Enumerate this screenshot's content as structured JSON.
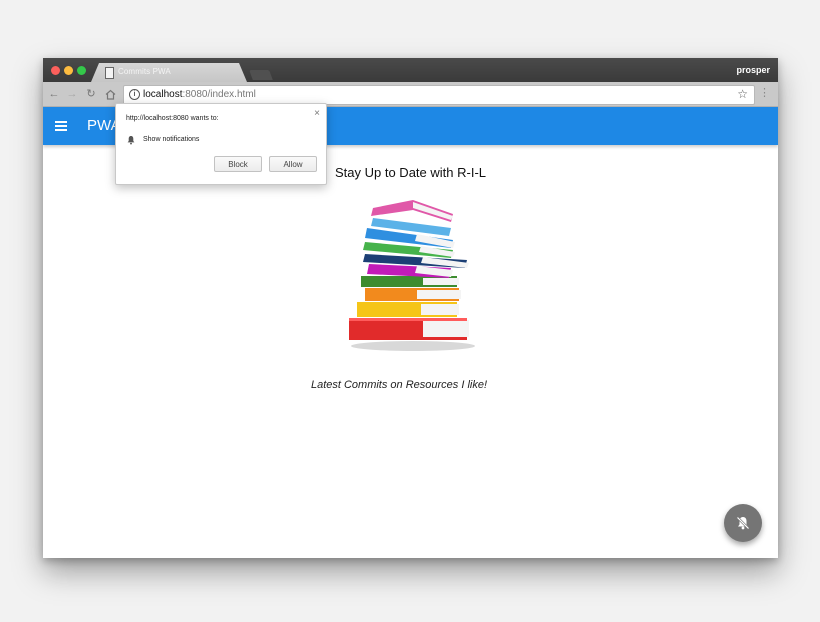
{
  "browser": {
    "tab_title": "Commits PWA",
    "profile_name": "prosper",
    "url_host": "localhost",
    "url_rest": ":8080/index.html",
    "icons": {
      "back": "arrow-left-icon",
      "forward": "arrow-right-icon",
      "reload": "reload-icon",
      "home": "home-icon",
      "info": "info-icon",
      "bookmark": "star-icon",
      "menu": "vertical-dots-icon"
    }
  },
  "app": {
    "title": "PWA",
    "heading": "Stay Up to Date with R-I-L",
    "caption": "Latest Commits on Resources I like!",
    "accent_color": "#1e88e5",
    "fab_icon": "bell-off-icon"
  },
  "permission_popup": {
    "origin_text": "http://localhost:8080 wants to:",
    "permission_label": "Show notifications",
    "block_label": "Block",
    "allow_label": "Allow",
    "close_symbol": "×"
  }
}
